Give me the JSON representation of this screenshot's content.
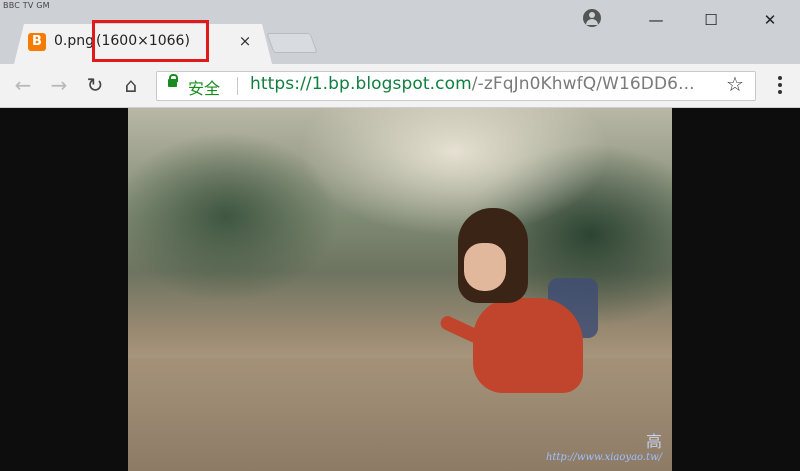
{
  "corner_label": "BBC TV GM",
  "tab": {
    "favicon_letter": "B",
    "title_name": "0.png",
    "title_dims": "(1600×1066)",
    "close_glyph": "×"
  },
  "window_controls": {
    "minimize": "—",
    "maximize": "☐",
    "close": "✕"
  },
  "toolbar": {
    "back": "←",
    "forward": "→",
    "reload": "↻",
    "home": "⌂",
    "secure_label": "安全",
    "url_host": "https://1.bp.blogspot.com",
    "url_rest": "/-zFqJn0KhwfQ/W16DD6...",
    "star": "☆"
  },
  "watermark": {
    "logo_text": "高",
    "url_text": "http://www.xiaoyao.tw/"
  },
  "colors": {
    "tab_bg": "#f2f2f2",
    "titlebar_bg": "#cdd0d4",
    "highlight": "#e0191b",
    "secure_green": "#198c1e",
    "favicon_orange": "#f57c00"
  }
}
